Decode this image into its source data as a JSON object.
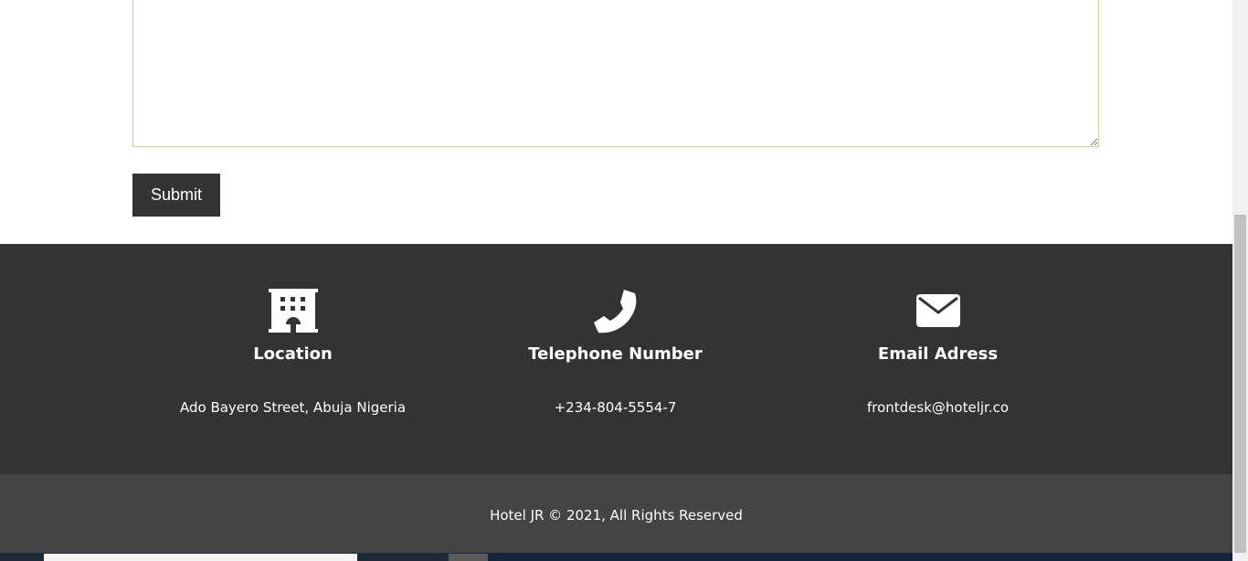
{
  "form": {
    "submit_label": "Submit"
  },
  "contact": {
    "location": {
      "icon": "building-icon",
      "heading": "Location",
      "value": "Ado Bayero Street, Abuja Nigeria"
    },
    "telephone": {
      "icon": "phone-icon",
      "heading": "Telephone Number",
      "value": "+234-804-5554-7"
    },
    "email": {
      "icon": "envelope-icon",
      "heading": "Email Adress",
      "value": "frontdesk@hoteljr.co"
    }
  },
  "footer": {
    "copyright": "Hotel JR © 2021, All Rights Reserved"
  },
  "colors": {
    "footer_bg": "#333333",
    "copyright_bg": "#444444",
    "button_bg": "#333333",
    "textarea_border": "#d9c89a",
    "text_light": "#ffffff"
  }
}
